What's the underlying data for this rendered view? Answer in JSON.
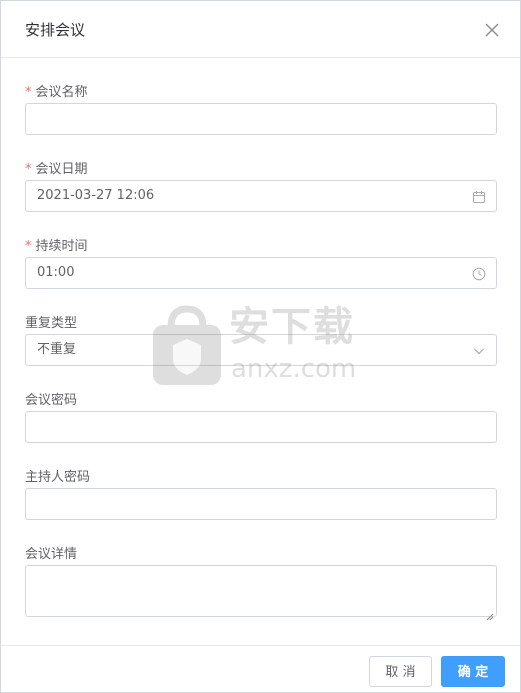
{
  "dialog": {
    "title": "安排会议",
    "close_icon": "close-icon"
  },
  "form": {
    "required_mark": "*",
    "meeting_name": {
      "label": "会议名称",
      "value": "",
      "placeholder": ""
    },
    "meeting_date": {
      "label": "会议日期",
      "value": "2021-03-27 12:06",
      "icon": "calendar-icon"
    },
    "duration": {
      "label": "持续时间",
      "value": "01:00",
      "icon": "clock-icon"
    },
    "repeat_type": {
      "label": "重复类型",
      "value": "不重复",
      "icon": "chevron-down-icon"
    },
    "meeting_password": {
      "label": "会议密码",
      "value": ""
    },
    "host_password": {
      "label": "主持人密码",
      "value": ""
    },
    "meeting_details": {
      "label": "会议详情",
      "value": ""
    }
  },
  "footer": {
    "cancel_label": "取 消",
    "ok_label": "确 定"
  },
  "watermark": {
    "text": "安下载",
    "subtext": "anxz.com"
  },
  "colors": {
    "primary": "#409eff",
    "required": "#f56c6c",
    "border": "#d3d6dc",
    "text": "#606266"
  }
}
